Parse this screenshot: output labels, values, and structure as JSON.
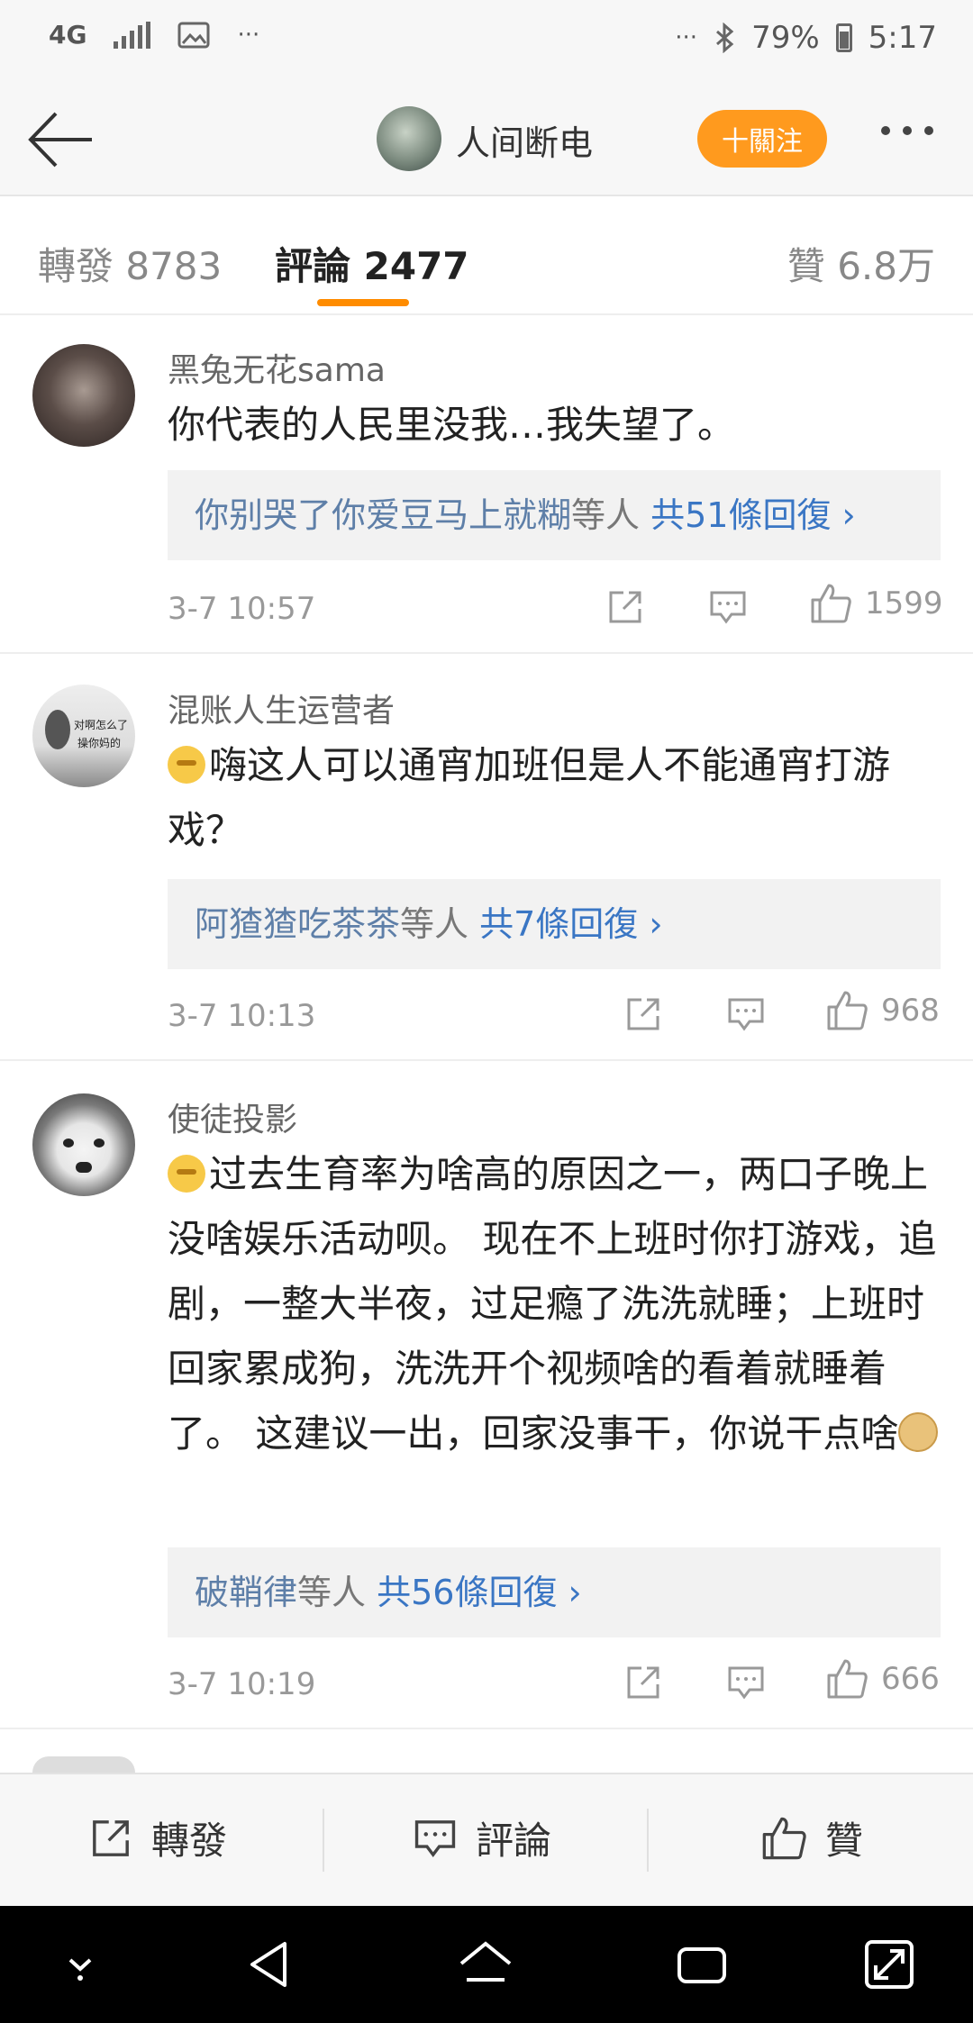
{
  "status_bar": {
    "network": "4G",
    "more": "···",
    "more2": "···",
    "battery": "79%",
    "time": "5:17"
  },
  "header": {
    "title": "人间断电",
    "follow_label": "十關注"
  },
  "tabs": {
    "repost": "轉發 8783",
    "comment": "評論 2477",
    "like": "贊 6.8万"
  },
  "comments": [
    {
      "user": "黑兔无花sama",
      "text": "你代表的人民里没我…我失望了。",
      "reply_names": "你别哭了你爱豆马上就糊",
      "reply_mid": "等人",
      "reply_total": "共51條回復 ›",
      "time": "3-7 10:57",
      "likes": "1599"
    },
    {
      "user": "混账人生运营者",
      "avatar_text_1": "对啊怎么了",
      "avatar_text_2": "操你妈的",
      "text": "嗨这人可以通宵加班但是人不能通宵打游戏？",
      "reply_names": "阿猹猹吃茶茶",
      "reply_mid": "等人",
      "reply_total": "共7條回復 ›",
      "time": "3-7 10:13",
      "likes": "968"
    },
    {
      "user": "使徒投影",
      "text": "过去生育率为啥高的原因之一，两口子晚上没啥娱乐活动呗。 现在不上班时你打游戏，追剧，一整大半夜，过足瘾了洗洗就睡；上班时回家累成狗，洗洗开个视频啥的看着就睡着了。 这建议一出，回家没事干，你说干点啥",
      "reply_names": "破鞘律",
      "reply_mid": "等人",
      "reply_total": "共56條回復 ›",
      "time": "3-7 10:19",
      "likes": "666"
    }
  ],
  "action_bar": {
    "repost": "轉發",
    "comment": "評論",
    "like": "贊"
  }
}
